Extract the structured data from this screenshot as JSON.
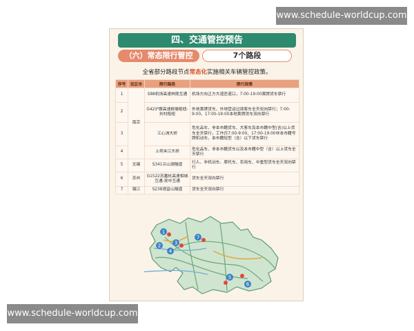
{
  "watermarks": {
    "top": "www.schedule-worldcup.com",
    "bottom": "www.schedule-worldcup.com"
  },
  "poster": {
    "header": "四、交通管控预告",
    "section_label": "（六）常态限行管控",
    "section_count": "7个路段",
    "description_pre": "全省部分路段节点",
    "description_emph": "常态化",
    "description_post": "实施相关车辆管控政策。",
    "table": {
      "headers": [
        "序号",
        "设区市",
        "限行路段",
        "限行政策"
      ],
      "rows": [
        {
          "no": "1",
          "city": "南京",
          "road": "S88机场高速林陵互通",
          "policy": "机场方向正方大道匝道口，7:00-19:00黄牌货车禁行"
        },
        {
          "no": "2",
          "city": "",
          "road": "G42沪蓉高速柳塘枢纽-刘村枢纽",
          "policy": "外地黄牌货车、外地营运过境客车全天双向禁行；7:00-9:00、17:00-19:00本地黄牌货车双向禁行"
        },
        {
          "no": "3",
          "city": "",
          "road": "江心洲大桥",
          "policy": "危化品车、非本市籍货车、大客车及本市籍中型(含)以上货车全天禁行，工作日7:00-9:00、17:00-19:00非本市籍号牌机动车、本市籍轻型（含）以下货车禁行"
        },
        {
          "no": "4",
          "city": "",
          "road": "上坝夹江大桥",
          "policy": "危化品车、非本市籍货车以及本市籍中型（含）以上货车全天禁行"
        },
        {
          "no": "5",
          "city": "无锡",
          "road": "S341兰山湖隧道",
          "policy": "行人、非机动车、摩托车、农用车、中重型货车全天双向禁行"
        },
        {
          "no": "6",
          "city": "苏州",
          "road": "G1522苏嘉杭高速相城互通-吴中互通",
          "policy": "货车全天双向禁行"
        },
        {
          "no": "7",
          "city": "镇江",
          "road": "S238观音山隧道",
          "policy": "货车全天双向禁行"
        }
      ]
    },
    "map": {
      "markers": [
        "1",
        "2",
        "3",
        "4",
        "5",
        "6",
        "7"
      ]
    }
  }
}
